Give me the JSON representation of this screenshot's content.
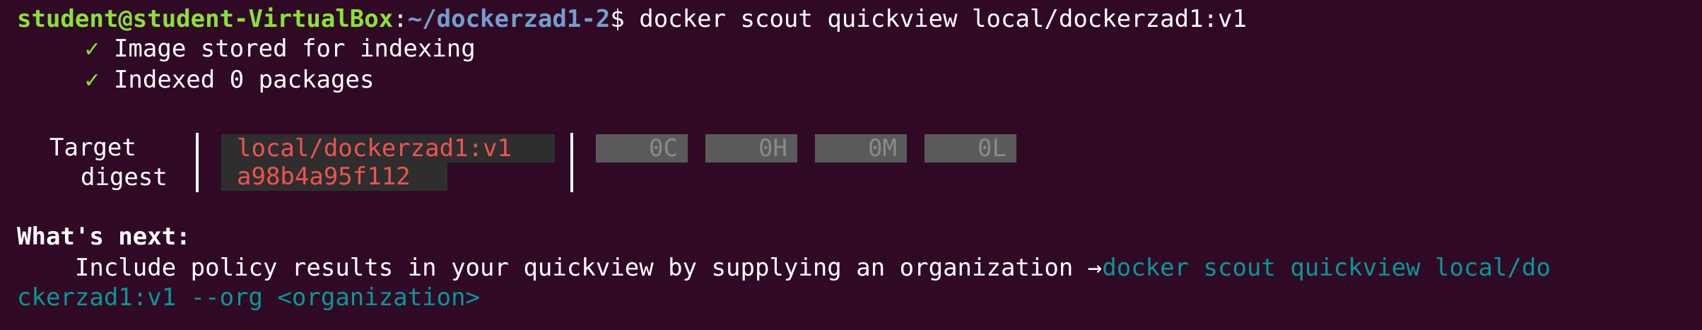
{
  "prompt": {
    "user_host": "student@student-VirtualBox",
    "separator": ":",
    "path": "~/dockerzad1-2",
    "symbol": "$",
    "command": " docker scout quickview local/dockerzad1:v1"
  },
  "status": [
    {
      "icon": "check-icon",
      "glyph": "✓",
      "text": " Image stored for indexing"
    },
    {
      "icon": "check-icon",
      "glyph": "✓",
      "text": " Indexed 0 packages"
    }
  ],
  "summary": {
    "target_label": "Target",
    "digest_label": "digest",
    "target_value": "local/dockerzad1:v1",
    "digest_value": "a98b4a95f112",
    "severities": [
      {
        "label": "0C"
      },
      {
        "label": "0H"
      },
      {
        "label": "0M"
      },
      {
        "label": "0L"
      }
    ]
  },
  "whats_next": {
    "heading": "What's next:",
    "text": "    Include policy results in your quickview by supplying an organization ",
    "arrow": "→",
    "command_part1": "docker scout quickview local/do",
    "command_part2": "ckerzad1:v1 --org <organization>"
  },
  "colors": {
    "background": "#300a24",
    "prompt_user": "#8ae234",
    "prompt_path": "#729fcf",
    "check": "#8ae234",
    "target_text": "#ef5350",
    "command_hint": "#06989a"
  }
}
